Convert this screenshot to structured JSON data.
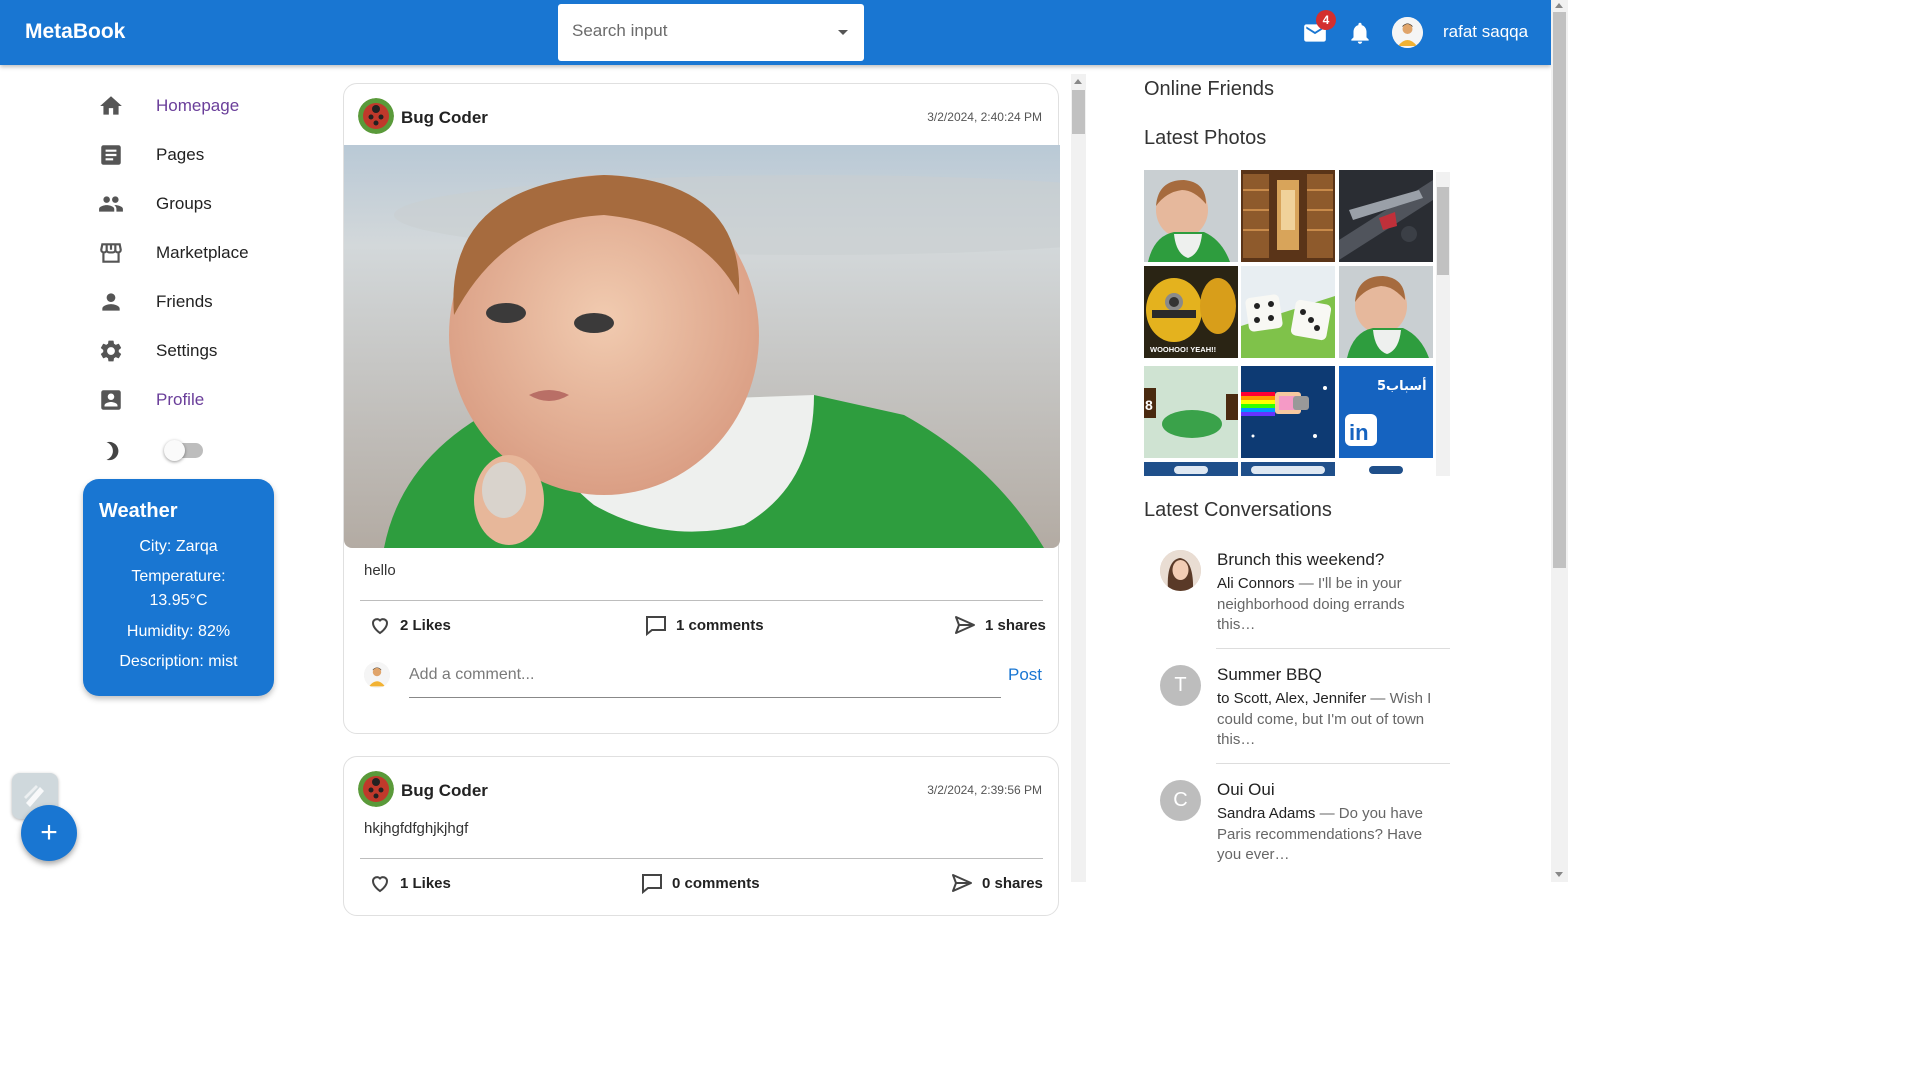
{
  "app": {
    "brand": "MetaBook"
  },
  "header": {
    "search_placeholder": "Search input",
    "mail_badge": "4",
    "username": "rafat saqqa",
    "icons": [
      "mail-icon",
      "bell-icon"
    ]
  },
  "sidebar": {
    "items": [
      {
        "label": "Homepage",
        "icon": "home-icon",
        "active": true
      },
      {
        "label": "Pages",
        "icon": "article-icon"
      },
      {
        "label": "Groups",
        "icon": "groups-icon"
      },
      {
        "label": "Marketplace",
        "icon": "storefront-icon"
      },
      {
        "label": "Friends",
        "icon": "person-icon"
      },
      {
        "label": "Settings",
        "icon": "gear-icon"
      },
      {
        "label": "Profile",
        "icon": "account-box-icon",
        "active": true
      }
    ],
    "dark_mode": false
  },
  "weather": {
    "title": "Weather",
    "city": "City: Zarqa",
    "temperature_label": "Temperature:",
    "temperature_value": "13.95°C",
    "humidity": "Humidity: 82%",
    "description": "Description: mist"
  },
  "posts": [
    {
      "author": "Bug Coder",
      "date": "3/2/2024, 2:40:24 PM",
      "text": "hello",
      "likes": "2 Likes",
      "comments": "1 comments",
      "shares": "1 shares",
      "comment_placeholder": "Add a comment...",
      "post_label": "Post"
    },
    {
      "author": "Bug Coder",
      "date": "3/2/2024, 2:39:56 PM",
      "text": "hkjhgfdfghjkjhgf",
      "likes": "1 Likes",
      "comments": "0 comments",
      "shares": "0 shares"
    }
  ],
  "right": {
    "online_friends": "Online Friends",
    "latest_photos": "Latest Photos",
    "latest_conversations": "Latest Conversations",
    "photo_captions": [
      "WOOHOO! YEAH!!",
      "أسباب5"
    ],
    "conversations": [
      {
        "title": "Brunch this weekend?",
        "sender": "Ali Connors",
        "snippet": " — I'll be in your neighborhood doing errands this…",
        "avatar_letter": ""
      },
      {
        "title": "Summer BBQ",
        "sender": "to Scott, Alex, Jennifer",
        "snippet": " — Wish I could come, but I'm out of town this…",
        "avatar_letter": "T"
      },
      {
        "title": "Oui Oui",
        "sender": "Sandra Adams",
        "snippet": " — Do you have Paris recommendations? Have you ever…",
        "avatar_letter": "C"
      }
    ]
  },
  "colors": {
    "primary": "#1976d2",
    "active_nav": "#6a3e9a",
    "badge": "#d32f2f"
  }
}
